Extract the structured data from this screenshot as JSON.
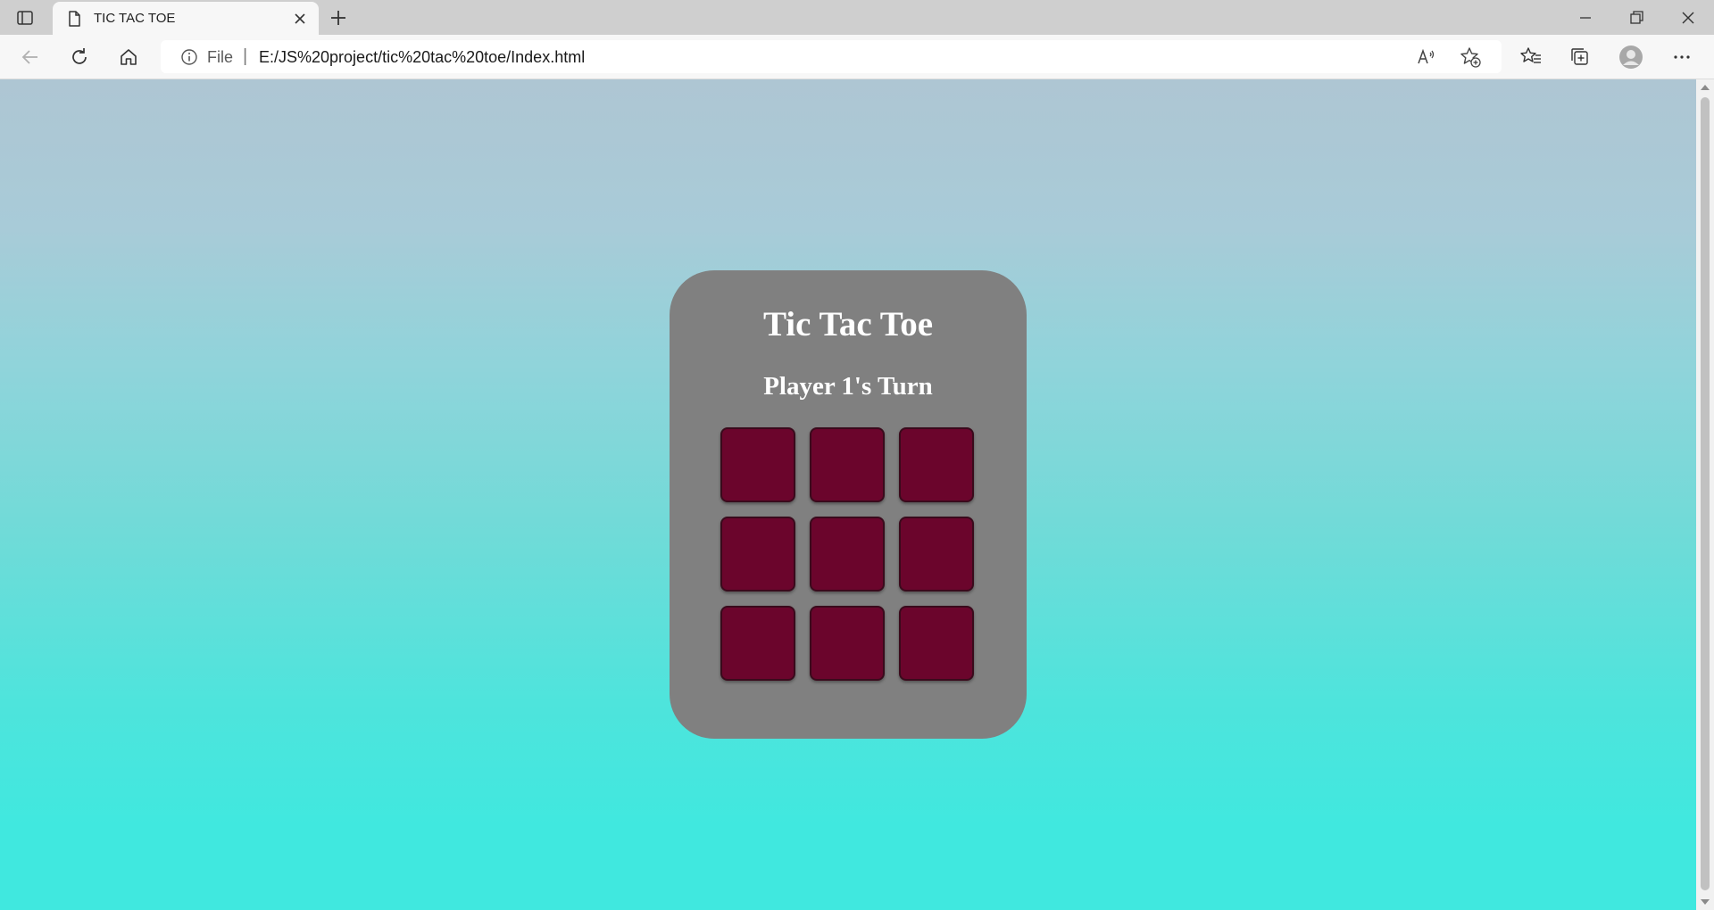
{
  "browser": {
    "tab": {
      "title": "TIC TAC TOE"
    },
    "address_bar": {
      "scheme_label": "File",
      "separator": "|",
      "url": "E:/JS%20project/tic%20tac%20toe/Index.html"
    }
  },
  "game": {
    "title": "Tic Tac Toe",
    "turn_label": "Player 1's Turn",
    "board": [
      "",
      "",
      "",
      "",
      "",
      "",
      "",
      "",
      ""
    ],
    "colors": {
      "card": "#808080",
      "cell": "#6b052c",
      "text": "#ffffff",
      "background_top": "#aec6d3",
      "background_bottom": "#40e8df"
    }
  }
}
